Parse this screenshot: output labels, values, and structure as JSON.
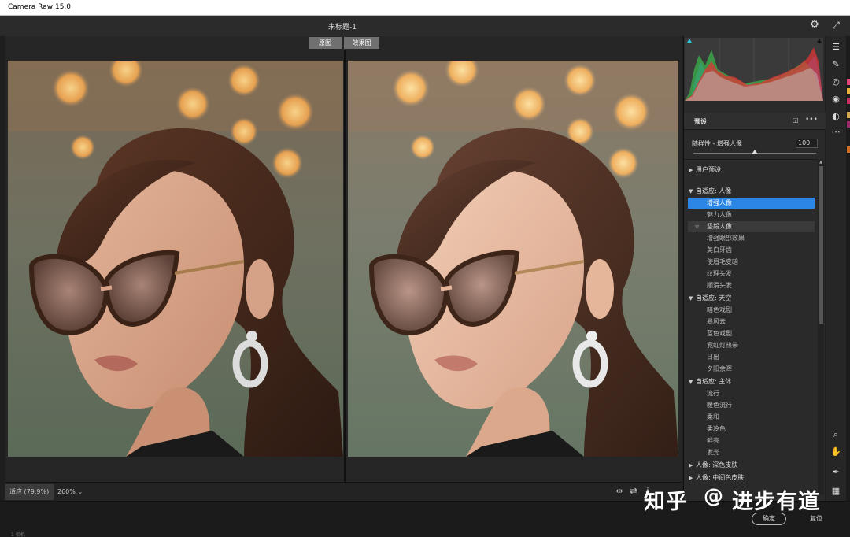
{
  "app": {
    "window_title": "Camera Raw 15.0",
    "document_title": "未标题-1"
  },
  "view": {
    "tabs": [
      "原图",
      "效果图"
    ]
  },
  "zoom": {
    "fit_label": "适应 (79.9%)",
    "percent_label": "260%"
  },
  "presets": {
    "header": "预设",
    "amount_label": "随样性 - 增强人像",
    "amount_value": "100",
    "amount_fraction": 1.0,
    "user_presets": "用户预设",
    "groups": [
      {
        "label": "自适应: 人像",
        "items": [
          "增强人像",
          "魅力人像",
          "坚毅人像",
          "增强眼部效果",
          "美白牙齿",
          "使眉毛变暗",
          "纹理头发",
          "顺滑头发"
        ]
      },
      {
        "label": "自适应: 天空",
        "items": [
          "暗色戏剧",
          "暴风云",
          "蓝色戏剧",
          "霓虹灯热带",
          "日出",
          "夕阳余晖"
        ]
      },
      {
        "label": "自适应: 主体",
        "items": [
          "流行",
          "暖色流行",
          "柔和",
          "柔冷色",
          "鲜亮",
          "发光"
        ]
      },
      {
        "label": "人像: 深色皮肤",
        "items": []
      },
      {
        "label": "人像: 中间色皮肤",
        "items": []
      }
    ],
    "selected_item": "增强人像",
    "hovered_item": "坚毅人像"
  },
  "footer": {
    "ok_label": "确定",
    "reset_label": "复位",
    "small_text": "1 相机"
  },
  "watermark": {
    "brand": "知乎",
    "at": "@",
    "author": "进步有道"
  },
  "colors": {
    "accent": "#2b86e5",
    "panel_bg": "#2a2a2a",
    "workspace_bg": "#262626",
    "swatches": [
      "#e0487c",
      "#e8b33a",
      "#c6305e",
      "#d3a84a",
      "#9c2b6d",
      "#cf6d24"
    ]
  }
}
